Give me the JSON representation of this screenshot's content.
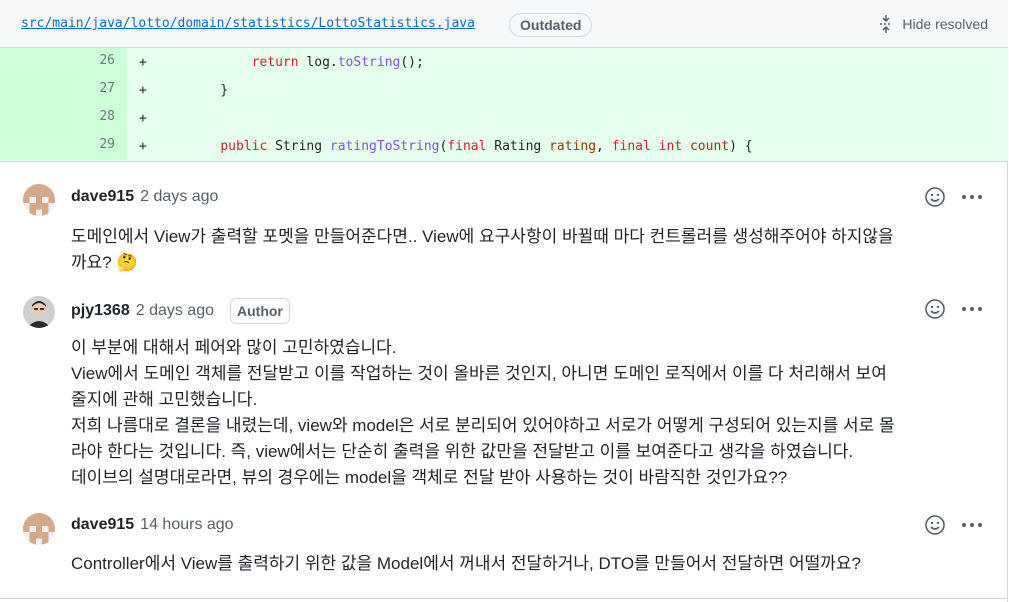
{
  "file_header": {
    "path": "src/main/java/lotto/domain/statistics/LottoStatistics.java",
    "badge": "Outdated",
    "hide_resolved_label": "Hide resolved"
  },
  "diff": {
    "rows": [
      {
        "line": "26",
        "sign": "+",
        "code": "        return log.toString();"
      },
      {
        "line": "27",
        "sign": "+",
        "code": "    }"
      },
      {
        "line": "28",
        "sign": "+",
        "code": ""
      },
      {
        "line": "29",
        "sign": "+",
        "code": "    public String ratingToString(final Rating rating, final int count) {"
      }
    ]
  },
  "comments": [
    {
      "author": "dave915",
      "time": "2 days ago",
      "badge": "",
      "body": [
        "도메인에서 View가 출력할 포멧을 만들어준다면.. View에 요구사항이 바뀔때 마다 컨트롤러를 생성해주어야 하지않을",
        "까요? 🤔"
      ]
    },
    {
      "author": "pjy1368",
      "time": "2 days ago",
      "badge": "Author",
      "body": [
        "이 부분에 대해서 페어와 많이 고민하였습니다.",
        "View에서 도메인 객체를 전달받고 이를 작업하는 것이 올바른 것인지, 아니면 도메인 로직에서 이를 다 처리해서 보여",
        "줄지에 관해 고민했습니다.",
        "저희 나름대로 결론을 내렸는데, view와 model은 서로 분리되어 있어야하고 서로가 어떻게 구성되어 있는지를 서로 몰",
        "라야 한다는 것입니다. 즉, view에서는 단순히 출력을 위한 값만을 전달받고 이를 보여준다고 생각을 하였습니다.",
        "데이브의 설명대로라면, 뷰의 경우에는 model을 객체로 전달 받아 사용하는 것이 바람직한 것인가요??"
      ]
    },
    {
      "author": "dave915",
      "time": "14 hours ago",
      "badge": "",
      "body": [
        "Controller에서 View를 출력하기 위한 값을 Model에서 꺼내서 전달하거나, DTO를 만들어서 전달하면 어떨까요?"
      ]
    }
  ],
  "colors": {
    "link": "#0969da",
    "diff_add_bg": "#e6ffec",
    "diff_add_gutter": "#ccffd8",
    "muted": "#57606a",
    "avatar_identicon": "#d4a98a"
  },
  "icons": [
    "unfold-icon",
    "smiley-icon",
    "kebab-horizontal-icon"
  ]
}
